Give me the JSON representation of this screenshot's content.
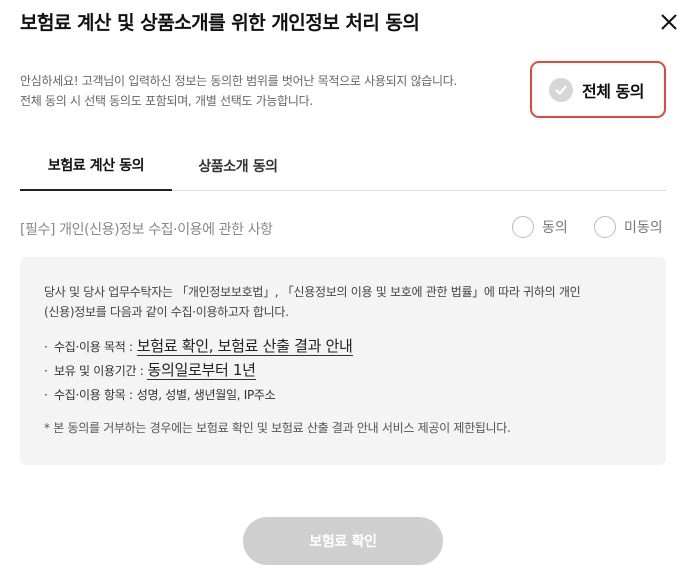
{
  "dialog": {
    "title": "보험료 계산 및 상품소개를 위한 개인정보 처리 동의",
    "close_icon": "close-icon"
  },
  "notice": {
    "line1": "안심하세요! 고객님이 입력하신 정보는 동의한 범위를 벗어난 목적으로 사용되지 않습니다.",
    "line2": "전체 동의 시 선택 동의도 포함되며, 개별 선택도 가능합니다."
  },
  "all_agree": {
    "label": "전체 동의",
    "checked": false,
    "border_color": "#e04a3a"
  },
  "tabs": [
    {
      "label": "보험료 계산 동의",
      "active": true
    },
    {
      "label": "상품소개 동의",
      "active": false
    }
  ],
  "section": {
    "title": "[필수] 개인(신용)정보 수집·이용에 관한 사항",
    "agree_label": "동의",
    "disagree_label": "미동의"
  },
  "info": {
    "intro_line1": "당사 및 당사 업무수탁자는 「개인정보보호법」, 「신용정보의 이용 및 보호에 관한 법률」에 따라 귀하의 개인",
    "intro_line2": "(신용)정보를 다음과 같이 수집·이용하고자 합니다.",
    "bullets": [
      {
        "label": "수집·이용 목적 :",
        "value": "보험료 확인, 보험료 산출 결과 안내",
        "emphasized": true
      },
      {
        "label": "보유 및 이용기간 :",
        "value": "동의일로부터 1년",
        "emphasized": true
      },
      {
        "label": "수집·이용 항목 :",
        "value": "성명, 성별, 생년월일, IP주소",
        "emphasized": false
      }
    ],
    "footnote": "* 본 동의를 거부하는 경우에는 보험료 확인 및 보험료 산출 결과 안내 서비스 제공이 제한됩니다."
  },
  "confirm_button": {
    "label": "보험료 확인",
    "enabled": false
  }
}
